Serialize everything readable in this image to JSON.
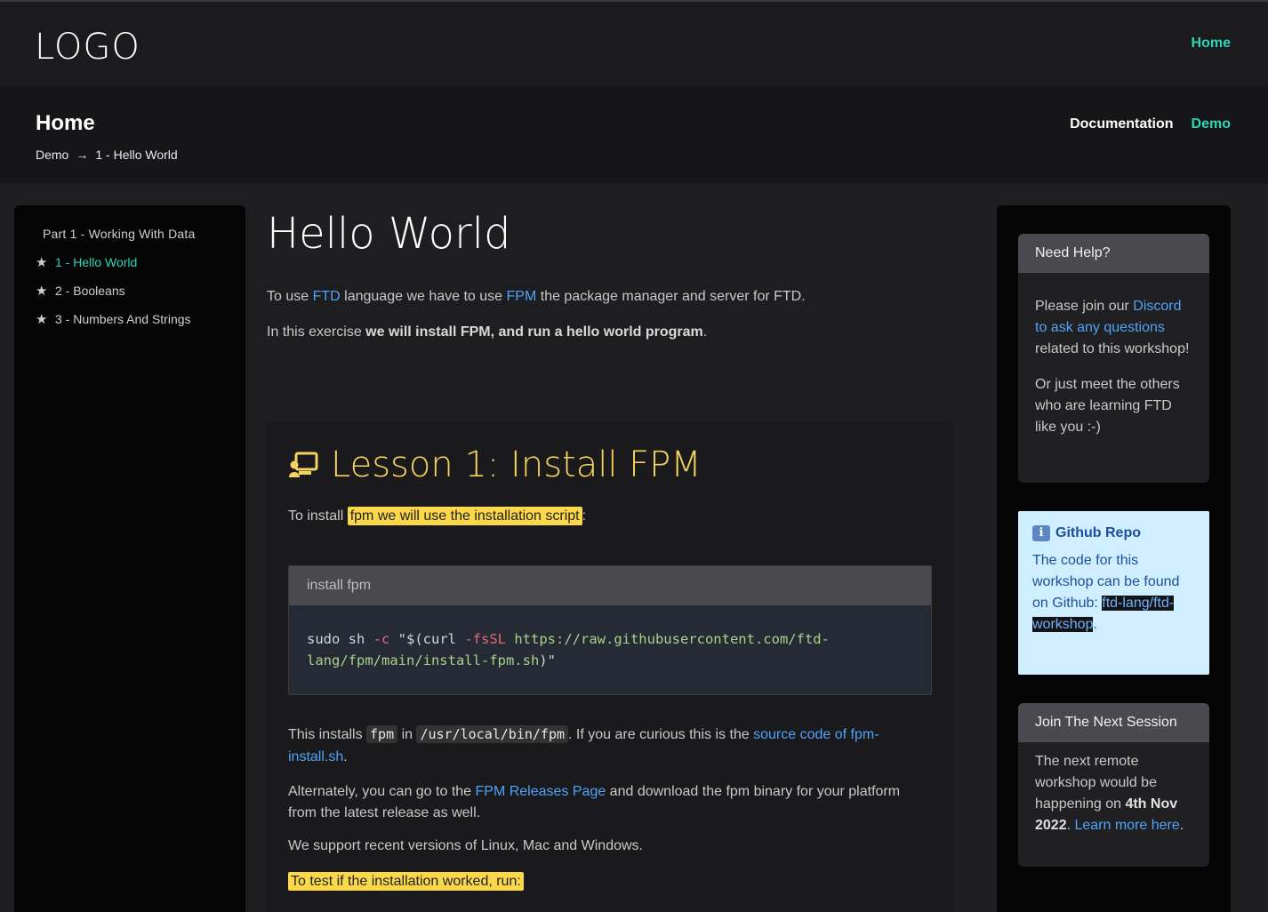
{
  "header": {
    "logo": "LOGO",
    "home": "Home"
  },
  "subheader": {
    "title": "Home",
    "breadcrumb": [
      "Demo",
      "1 - Hello World"
    ],
    "nav": [
      "Documentation",
      "Demo"
    ]
  },
  "sidebar": {
    "part": "Part 1 - Working With Data",
    "items": [
      {
        "label": "1 - Hello World"
      },
      {
        "label": "2 - Booleans"
      },
      {
        "label": "3 - Numbers And Strings"
      }
    ]
  },
  "main": {
    "title": "Hello World",
    "p1": {
      "a": "To use ",
      "link1": "FTD",
      "b": " language we have to use ",
      "link2": "FPM",
      "c": " the package manager and server for FTD."
    },
    "p2": {
      "a": "In this exercise ",
      "bold": "we will install FPM, and run a hello world program",
      "c": "."
    }
  },
  "lesson": {
    "title": "Lesson 1: Install FPM",
    "intro": {
      "a": "To install ",
      "highlight": "fpm we will use the installation script",
      "c": ":"
    },
    "code": {
      "caption": "install fpm",
      "line1_cmd": "sudo sh ",
      "line1_flag": "-c",
      "line1_mid": " \"$(curl ",
      "line1_flag2": "-fsSL",
      "line1_url": " https://raw.githubusercontent.com/ftd-",
      "line2_url": "lang/fpm/main/install-fpm.sh",
      "line2_end": ")\""
    },
    "installs": {
      "a": "This installs ",
      "code1": "fpm",
      "b": " in ",
      "code2": "/usr/local/bin/fpm",
      "c": ". If you are curious this is the ",
      "link": "source code of fpm-install.sh",
      "d": "."
    },
    "alternate": {
      "a": "Alternately, you can go to the ",
      "link": "FPM Releases Page",
      "b": " and download the fpm binary for your platform from the latest release as well."
    },
    "support": "We support recent versions of Linux, Mac and Windows.",
    "test": "To test if the installation worked, run:"
  },
  "help_card": {
    "title": "Need Help?",
    "p1": {
      "a": "Please join our ",
      "link": "Discord to ask any questions",
      "b": " related to this workshop!"
    },
    "p2": "Or just meet the others who are learning FTD like you :-)"
  },
  "github_card": {
    "title": "Github Repo",
    "text": "The code for this workshop can be found on Github: ",
    "link": "ftd-lang/ftd-workshop",
    "end": "."
  },
  "session_card": {
    "title": "Join The Next Session",
    "a": "The next remote workshop would be happening on ",
    "bold": "4th Nov 2022",
    "b": ". ",
    "link": "Learn more here",
    "c": "."
  },
  "colors": {
    "accent": "#2fd4b4",
    "link": "#4fa3f7",
    "lesson_title": "#f4d35e",
    "highlight": "#fad84a"
  }
}
